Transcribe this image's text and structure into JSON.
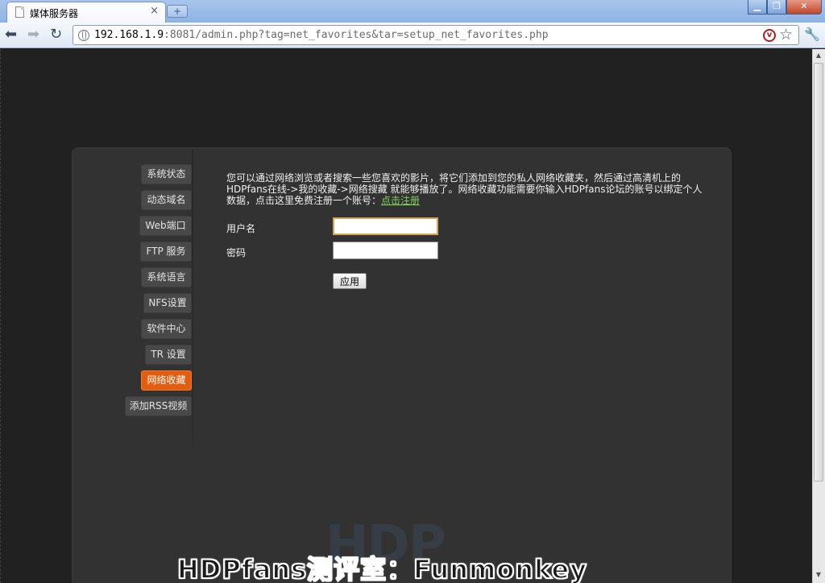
{
  "browser": {
    "tab_title": "媒体服务器",
    "tab_close": "×",
    "new_tab": "+",
    "url_host": "192.168.1.9",
    "url_rest": ":8081/admin.php?tag=net_favorites&tar=setup_net_favorites.php",
    "icons": [
      "doc-icon",
      "back-icon",
      "forward-icon",
      "reload-icon",
      "globe-icon",
      "extension-icon",
      "star-icon",
      "wrench-icon"
    ],
    "window_controls": {
      "minimize": "▁",
      "maximize": "❐",
      "close": "✕"
    }
  },
  "sidebar": {
    "items": [
      {
        "label": "系统状态"
      },
      {
        "label": "动态域名"
      },
      {
        "label": "Web端口"
      },
      {
        "label": "FTP 服务"
      },
      {
        "label": "系统语言"
      },
      {
        "label": "NFS设置"
      },
      {
        "label": "软件中心"
      },
      {
        "label": "TR 设置"
      },
      {
        "label": "网络收藏",
        "active": true
      },
      {
        "label": "添加RSS视频"
      }
    ]
  },
  "main": {
    "description": "您可以通过网络浏览或者搜索一些您喜欢的影片，将它们添加到您的私人网络收藏夹，然后通过高清机上的HDPfans在线->我的收藏->网络搜藏 就能够播放了。网络收藏功能需要你输入HDPfans论坛的账号以绑定个人数据，点击这里免费注册一个账号：",
    "register_link": "点击注册",
    "username_label": "用户名",
    "username_value": "",
    "password_label": "密码",
    "password_value": "",
    "apply_label": "应用"
  },
  "watermark": "HDP",
  "overlay": "HDPfans测评室：Funmonkey",
  "colors": {
    "active": "#e35d0e",
    "link": "#7ed35b",
    "panel": "#333232"
  }
}
